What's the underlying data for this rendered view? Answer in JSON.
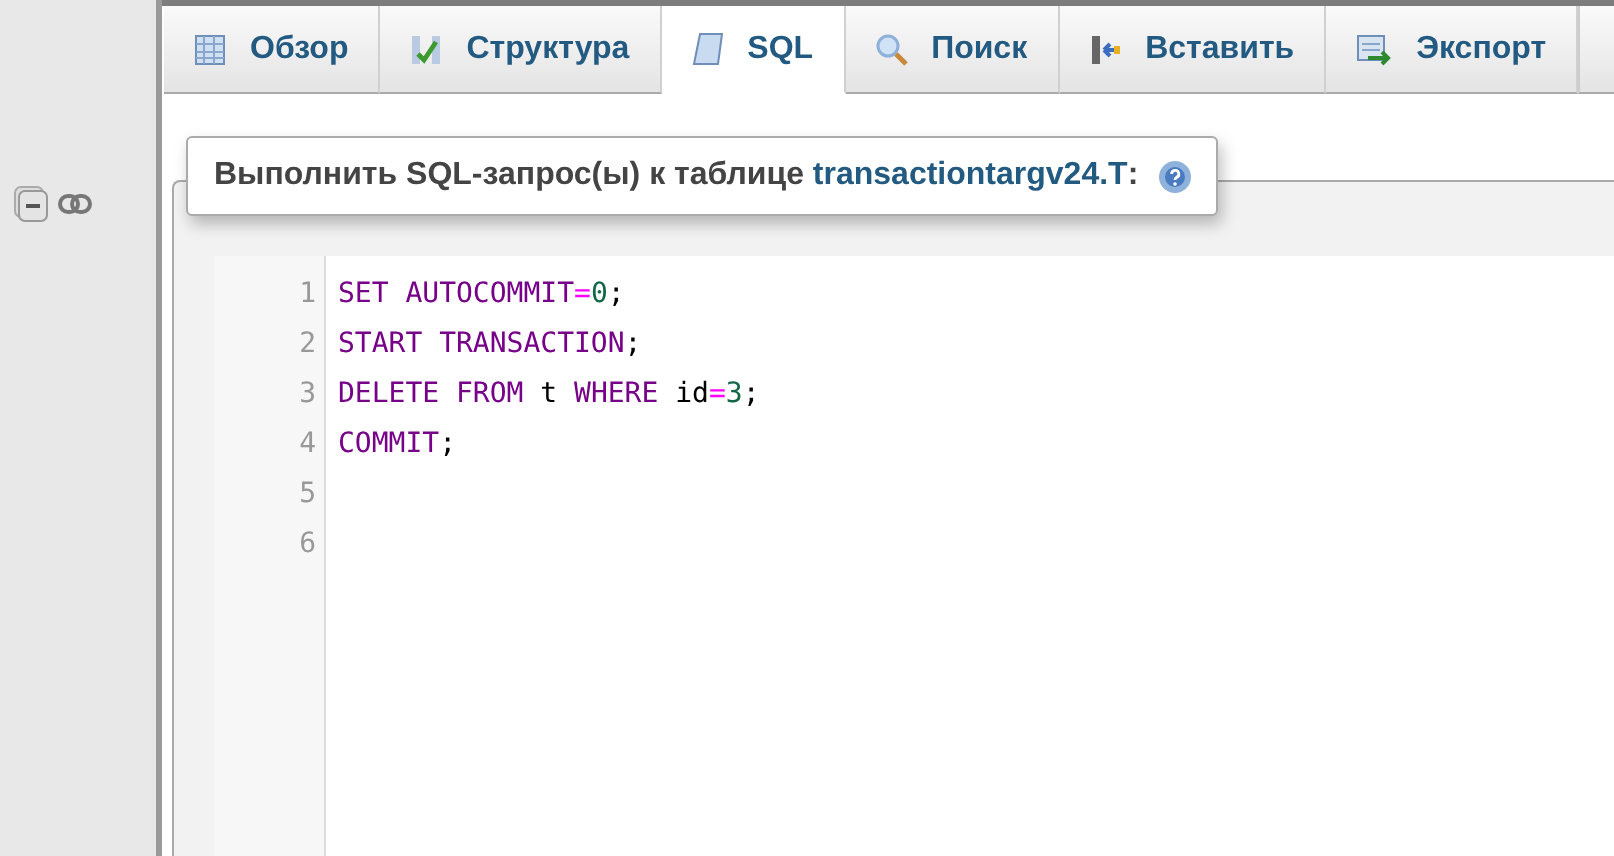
{
  "tabs": [
    {
      "label": "Обзор",
      "selected": false
    },
    {
      "label": "Структура",
      "selected": false
    },
    {
      "label": "SQL",
      "selected": true
    },
    {
      "label": "Поиск",
      "selected": false
    },
    {
      "label": "Вставить",
      "selected": false
    },
    {
      "label": "Экспорт",
      "selected": false
    }
  ],
  "query_panel": {
    "heading": "Выполнить SQL-запрос(ы) к таблице **transactiontargv24.T**:"
  },
  "editor": {
    "lines": [
      {
        "number": "1",
        "tokens": [
          {
            "text": "SET AUTOCOMMIT",
            "kind": "keyword"
          },
          {
            "text": "=",
            "kind": "operator"
          },
          {
            "text": "0",
            "kind": "number"
          },
          {
            "text": ";",
            "kind": "plain"
          }
        ]
      },
      {
        "number": "2",
        "tokens": [
          {
            "text": "START TRANSACTION",
            "kind": "keyword"
          },
          {
            "text": ";",
            "kind": "plain"
          }
        ]
      },
      {
        "number": "3",
        "tokens": [
          {
            "text": "DELETE FROM",
            "kind": "keyword"
          },
          {
            "text": " t ",
            "kind": "plain"
          },
          {
            "text": "WHERE",
            "kind": "keyword"
          },
          {
            "text": " id",
            "kind": "plain"
          },
          {
            "text": "=",
            "kind": "operator"
          },
          {
            "text": "3",
            "kind": "number"
          },
          {
            "text": ";",
            "kind": "plain"
          }
        ]
      },
      {
        "number": "4",
        "tokens": [
          {
            "text": "COMMIT",
            "kind": "keyword"
          },
          {
            "text": ";",
            "kind": "plain"
          }
        ]
      },
      {
        "number": "5"
      },
      {
        "number": "6"
      }
    ]
  }
}
